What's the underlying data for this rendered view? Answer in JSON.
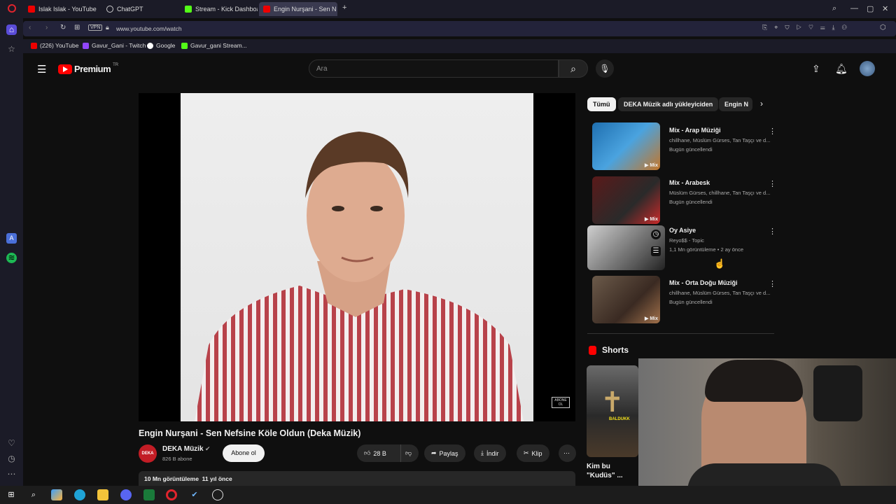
{
  "browser": {
    "tabs": [
      "Islak Islak - YouTube",
      "ChatGPT",
      "Stream - Kick Dashboard",
      "Engin Nurşani - Sen N"
    ],
    "url": "www.youtube.com/watch",
    "vpn": "VPN",
    "bookmarks": [
      "(226) YouTube",
      "Gavur_Gani - Twitch",
      "Google",
      "Gavur_gani Stream..."
    ]
  },
  "youtube": {
    "logo": "Premium",
    "logo_region": "TR",
    "search_placeholder": "Ara",
    "chips": [
      "Tümü",
      "DEKA Müzik adlı yükleyiciden",
      "Engin N"
    ],
    "video": {
      "title": "Engin Nurşani - Sen Nefsine Köle Oldun (Deka Müzik)",
      "channel": "DEKA Müzik",
      "subscribers": "826 B abone",
      "subscribe_label": "Abone ol",
      "likes": "28 B",
      "share": "Paylaş",
      "download": "İndir",
      "clip": "Klip",
      "views": "10 Mn görüntüleme",
      "age": "11 yıl önce",
      "watermark": "ABONE OL"
    },
    "recommendations": [
      {
        "title": "Mix - Arap Müziği",
        "meta1": "chillhane, Müslüm Gürses, Tan Taşçı ve d...",
        "meta2": "Bugün güncellendi",
        "badge": "Mix"
      },
      {
        "title": "Mix - Arabesk",
        "meta1": "Müslüm Gürses, chillhane, Tan Taşçı ve d...",
        "meta2": "Bugün güncellendi",
        "badge": "Mix"
      },
      {
        "title": "Oy Asiye",
        "meta1": "Reyo$$ - Topic",
        "meta2": "1,1 Mn görüntüleme • 2 ay önce",
        "badge": ""
      },
      {
        "title": "Mix - Orta Doğu Müziği",
        "meta1": "chillhane, Müslüm Gürses, Tan Taşçı ve d...",
        "meta2": "Bugün güncellendi",
        "badge": "Mix"
      }
    ],
    "shorts": {
      "heading": "Shorts",
      "item_title_1": "Kim bu",
      "item_title_2": "\"Kudüs\" ...",
      "thumb_text": "BALDUKK"
    }
  }
}
